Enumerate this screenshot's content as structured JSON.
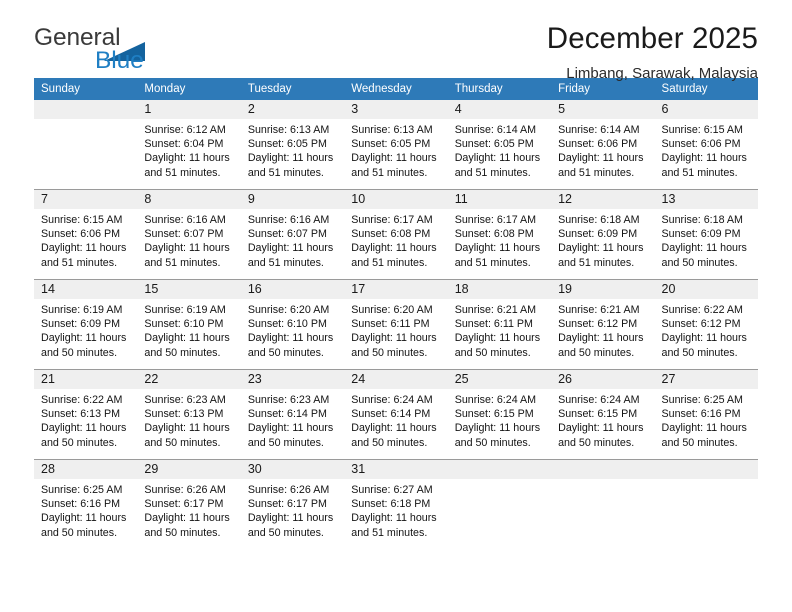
{
  "brand": {
    "name_part1": "General",
    "name_part2": "Blue",
    "triangle_color": "#14639e",
    "blue": "#1f7fc4"
  },
  "header": {
    "title": "December 2025",
    "subtitle": "Limbang, Sarawak, Malaysia",
    "header_bg": "#2e7ab8",
    "daynum_bg": "#efefef"
  },
  "weekday_headers": [
    "Sunday",
    "Monday",
    "Tuesday",
    "Wednesday",
    "Thursday",
    "Friday",
    "Saturday"
  ],
  "labels": {
    "sunrise_prefix": "Sunrise:",
    "sunset_prefix": "Sunset:",
    "daylight_prefix": "Daylight:"
  },
  "weeks": [
    [
      {
        "day": "",
        "empty": true
      },
      {
        "day": "1",
        "l1": "Sunrise: 6:12 AM",
        "l2": "Sunset: 6:04 PM",
        "l3": "Daylight: 11 hours",
        "l4": "and 51 minutes."
      },
      {
        "day": "2",
        "l1": "Sunrise: 6:13 AM",
        "l2": "Sunset: 6:05 PM",
        "l3": "Daylight: 11 hours",
        "l4": "and 51 minutes."
      },
      {
        "day": "3",
        "l1": "Sunrise: 6:13 AM",
        "l2": "Sunset: 6:05 PM",
        "l3": "Daylight: 11 hours",
        "l4": "and 51 minutes."
      },
      {
        "day": "4",
        "l1": "Sunrise: 6:14 AM",
        "l2": "Sunset: 6:05 PM",
        "l3": "Daylight: 11 hours",
        "l4": "and 51 minutes."
      },
      {
        "day": "5",
        "l1": "Sunrise: 6:14 AM",
        "l2": "Sunset: 6:06 PM",
        "l3": "Daylight: 11 hours",
        "l4": "and 51 minutes."
      },
      {
        "day": "6",
        "l1": "Sunrise: 6:15 AM",
        "l2": "Sunset: 6:06 PM",
        "l3": "Daylight: 11 hours",
        "l4": "and 51 minutes."
      }
    ],
    [
      {
        "day": "7",
        "l1": "Sunrise: 6:15 AM",
        "l2": "Sunset: 6:06 PM",
        "l3": "Daylight: 11 hours",
        "l4": "and 51 minutes."
      },
      {
        "day": "8",
        "l1": "Sunrise: 6:16 AM",
        "l2": "Sunset: 6:07 PM",
        "l3": "Daylight: 11 hours",
        "l4": "and 51 minutes."
      },
      {
        "day": "9",
        "l1": "Sunrise: 6:16 AM",
        "l2": "Sunset: 6:07 PM",
        "l3": "Daylight: 11 hours",
        "l4": "and 51 minutes."
      },
      {
        "day": "10",
        "l1": "Sunrise: 6:17 AM",
        "l2": "Sunset: 6:08 PM",
        "l3": "Daylight: 11 hours",
        "l4": "and 51 minutes."
      },
      {
        "day": "11",
        "l1": "Sunrise: 6:17 AM",
        "l2": "Sunset: 6:08 PM",
        "l3": "Daylight: 11 hours",
        "l4": "and 51 minutes."
      },
      {
        "day": "12",
        "l1": "Sunrise: 6:18 AM",
        "l2": "Sunset: 6:09 PM",
        "l3": "Daylight: 11 hours",
        "l4": "and 51 minutes."
      },
      {
        "day": "13",
        "l1": "Sunrise: 6:18 AM",
        "l2": "Sunset: 6:09 PM",
        "l3": "Daylight: 11 hours",
        "l4": "and 50 minutes."
      }
    ],
    [
      {
        "day": "14",
        "l1": "Sunrise: 6:19 AM",
        "l2": "Sunset: 6:09 PM",
        "l3": "Daylight: 11 hours",
        "l4": "and 50 minutes."
      },
      {
        "day": "15",
        "l1": "Sunrise: 6:19 AM",
        "l2": "Sunset: 6:10 PM",
        "l3": "Daylight: 11 hours",
        "l4": "and 50 minutes."
      },
      {
        "day": "16",
        "l1": "Sunrise: 6:20 AM",
        "l2": "Sunset: 6:10 PM",
        "l3": "Daylight: 11 hours",
        "l4": "and 50 minutes."
      },
      {
        "day": "17",
        "l1": "Sunrise: 6:20 AM",
        "l2": "Sunset: 6:11 PM",
        "l3": "Daylight: 11 hours",
        "l4": "and 50 minutes."
      },
      {
        "day": "18",
        "l1": "Sunrise: 6:21 AM",
        "l2": "Sunset: 6:11 PM",
        "l3": "Daylight: 11 hours",
        "l4": "and 50 minutes."
      },
      {
        "day": "19",
        "l1": "Sunrise: 6:21 AM",
        "l2": "Sunset: 6:12 PM",
        "l3": "Daylight: 11 hours",
        "l4": "and 50 minutes."
      },
      {
        "day": "20",
        "l1": "Sunrise: 6:22 AM",
        "l2": "Sunset: 6:12 PM",
        "l3": "Daylight: 11 hours",
        "l4": "and 50 minutes."
      }
    ],
    [
      {
        "day": "21",
        "l1": "Sunrise: 6:22 AM",
        "l2": "Sunset: 6:13 PM",
        "l3": "Daylight: 11 hours",
        "l4": "and 50 minutes."
      },
      {
        "day": "22",
        "l1": "Sunrise: 6:23 AM",
        "l2": "Sunset: 6:13 PM",
        "l3": "Daylight: 11 hours",
        "l4": "and 50 minutes."
      },
      {
        "day": "23",
        "l1": "Sunrise: 6:23 AM",
        "l2": "Sunset: 6:14 PM",
        "l3": "Daylight: 11 hours",
        "l4": "and 50 minutes."
      },
      {
        "day": "24",
        "l1": "Sunrise: 6:24 AM",
        "l2": "Sunset: 6:14 PM",
        "l3": "Daylight: 11 hours",
        "l4": "and 50 minutes."
      },
      {
        "day": "25",
        "l1": "Sunrise: 6:24 AM",
        "l2": "Sunset: 6:15 PM",
        "l3": "Daylight: 11 hours",
        "l4": "and 50 minutes."
      },
      {
        "day": "26",
        "l1": "Sunrise: 6:24 AM",
        "l2": "Sunset: 6:15 PM",
        "l3": "Daylight: 11 hours",
        "l4": "and 50 minutes."
      },
      {
        "day": "27",
        "l1": "Sunrise: 6:25 AM",
        "l2": "Sunset: 6:16 PM",
        "l3": "Daylight: 11 hours",
        "l4": "and 50 minutes."
      }
    ],
    [
      {
        "day": "28",
        "l1": "Sunrise: 6:25 AM",
        "l2": "Sunset: 6:16 PM",
        "l3": "Daylight: 11 hours",
        "l4": "and 50 minutes."
      },
      {
        "day": "29",
        "l1": "Sunrise: 6:26 AM",
        "l2": "Sunset: 6:17 PM",
        "l3": "Daylight: 11 hours",
        "l4": "and 50 minutes."
      },
      {
        "day": "30",
        "l1": "Sunrise: 6:26 AM",
        "l2": "Sunset: 6:17 PM",
        "l3": "Daylight: 11 hours",
        "l4": "and 50 minutes."
      },
      {
        "day": "31",
        "l1": "Sunrise: 6:27 AM",
        "l2": "Sunset: 6:18 PM",
        "l3": "Daylight: 11 hours",
        "l4": "and 51 minutes."
      },
      {
        "day": "",
        "empty": true
      },
      {
        "day": "",
        "empty": true
      },
      {
        "day": "",
        "empty": true
      }
    ]
  ]
}
